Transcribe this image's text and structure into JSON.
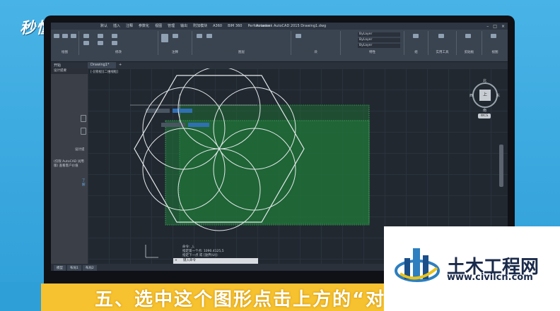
{
  "brand": {
    "logo_text": "秒懂视频"
  },
  "window": {
    "title": "Autodesk AutoCAD 2015  Drawing1.dwg",
    "menu": [
      "默认",
      "插入",
      "注释",
      "参数化",
      "视图",
      "管理",
      "输出",
      "附加模块",
      "A360",
      "BIM 360",
      "Performance"
    ]
  },
  "ribbon": {
    "groups": [
      "绘图",
      "修改",
      "注释",
      "图层",
      "块",
      "特性",
      "组",
      "实用工具",
      "剪贴板",
      "视图"
    ],
    "layer_value": "ByLayer"
  },
  "tabs": {
    "start": "开始",
    "document": "Drawing1*",
    "plus": "+"
  },
  "left_panel": {
    "header": "设计提要",
    "label": "设计提",
    "desc": "(仅限 AutoCAD 试用版) 查看客户价值",
    "link": "了解"
  },
  "viewport": {
    "label": "[-][俯视][二维线框]"
  },
  "viewcube": {
    "north": "北",
    "south": "南",
    "east": "东",
    "west": "西",
    "face": "上",
    "wcs": "WCS"
  },
  "command": {
    "history": [
      "命令: _L",
      "指定第一个点: 1090.4125,5",
      "指定下一点 或 [放弃(U)]:"
    ],
    "prompt": "键入命令"
  },
  "layout_tabs": [
    "模型",
    "布局1",
    "布局2"
  ],
  "caption": {
    "text": "五、选中这个图形点击上方的“对"
  },
  "watermark": {
    "title": "土木工程网",
    "url": "www.civilcn.com"
  },
  "colors": {
    "background": "#3aa7dc",
    "caption_bg": "#f7c22f",
    "selection": "#1f7a3a",
    "lines": "#e6e9ec"
  }
}
